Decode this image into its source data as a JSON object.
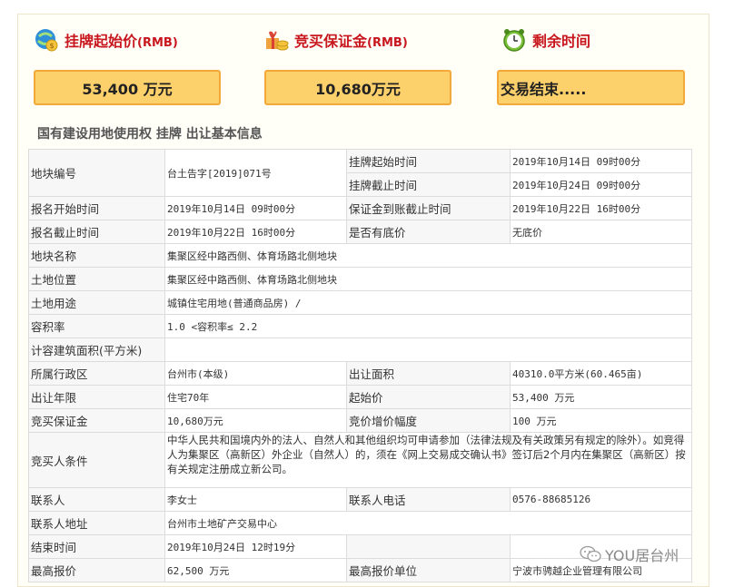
{
  "stats": {
    "start_price": {
      "label": "挂牌起始价",
      "unit": "(RMB)",
      "value": "53,400 万元"
    },
    "deposit": {
      "label": "竞买保证金",
      "unit": "(RMB)",
      "value": "10,680万元"
    },
    "remaining": {
      "label": "剩余时间",
      "value": "交易结束....."
    }
  },
  "section_title": "国有建设用地使用权 挂牌 出让基本信息",
  "rows": {
    "r1": {
      "k1": "地块编号",
      "v1": "台土告字[2019]071号",
      "k2": "挂牌起始时间",
      "v2": "2019年10月14日 09时00分",
      "k3": "挂牌截止时间",
      "v3": "2019年10月24日 09时00分"
    },
    "r2": {
      "k1": "报名开始时间",
      "v1": "2019年10月14日 09时00分",
      "k2": "保证金到账截止时间",
      "v2": "2019年10月22日 16时00分"
    },
    "r3": {
      "k1": "报名截止时间",
      "v1": "2019年10月22日 16时00分",
      "k2": "是否有底价",
      "v2": "无底价"
    },
    "r4": {
      "k1": "地块名称",
      "v1": "集聚区经中路西侧、体育场路北侧地块"
    },
    "r5": {
      "k1": "土地位置",
      "v1": "集聚区经中路西侧、体育场路北侧地块"
    },
    "r6": {
      "k1": "土地用途",
      "v1": "城镇住宅用地(普通商品房) /"
    },
    "r7": {
      "k1": "容积率",
      "v1": "1.0 <容积率≤ 2.2"
    },
    "r8": {
      "k1": "计容建筑面积(平方米)",
      "v1": ""
    },
    "r9": {
      "k1": "所属行政区",
      "v1": "台州市(本级)",
      "k2": "出让面积",
      "v2": "40310.0平方米(60.465亩)"
    },
    "r10": {
      "k1": "出让年限",
      "v1": "住宅70年",
      "k2": "起始价",
      "v2": "53,400 万元"
    },
    "r11": {
      "k1": "竞买保证金",
      "v1": "10,680万元",
      "k2": "竞价增价幅度",
      "v2": "100 万元"
    },
    "r12": {
      "k1": "竞买人条件",
      "v1": "中华人民共和国境内外的法人、自然人和其他组织均可申请参加（法律法规及有关政策另有规定的除外）。如竞得人为集聚区（高新区）外企业（自然人）的，须在《网上交易成交确认书》签订后2个月内在集聚区（高新区）按有关规定注册成立新公司。"
    },
    "r13": {
      "k1": "联系人",
      "v1": "李女士",
      "k2": "联系人电话",
      "v2": "0576-88685126"
    },
    "r14": {
      "k1": "联系人地址",
      "v1": "台州市土地矿产交易中心"
    },
    "r15": {
      "k1": "结束时间",
      "v1": "2019年10月24日 12时19分",
      "k2": "",
      "v2": ""
    },
    "r16": {
      "k1": "最高报价",
      "v1": "62,500 万元",
      "k2": "最高报价单位",
      "v2": "宁波市骋越企业管理有限公司"
    }
  },
  "watermark": "YOU居台州",
  "icons": [
    "money-globe-icon",
    "gift-coins-icon",
    "alarm-clock-icon",
    "wechat-icon"
  ],
  "colors": {
    "accent_red": "#c8161e",
    "box_fill": "#fcd06a",
    "box_border": "#f3a93a"
  }
}
